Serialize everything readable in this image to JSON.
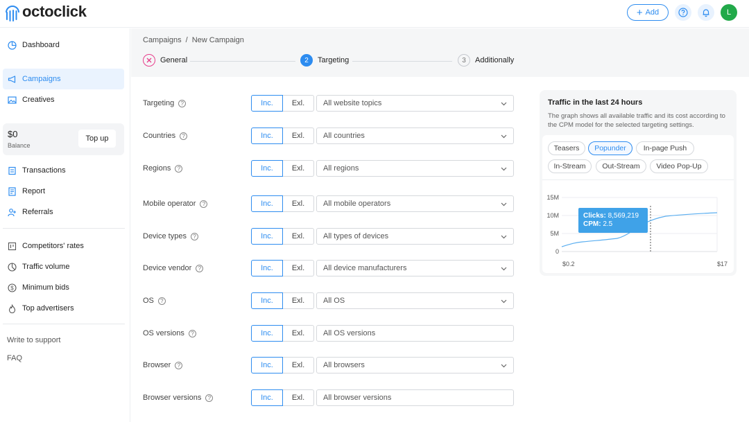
{
  "header": {
    "logo_text": "octoclick",
    "add_label": "Add",
    "avatar_letter": "L"
  },
  "sidebar": {
    "items_top": [
      {
        "label": "Dashboard",
        "icon": "dashboard-icon"
      },
      {
        "label": "Campaigns",
        "icon": "megaphone-icon"
      },
      {
        "label": "Creatives",
        "icon": "image-icon"
      }
    ],
    "balance": {
      "amount": "$0",
      "label": "Balance",
      "topup_label": "Top up"
    },
    "items_mid": [
      {
        "label": "Transactions",
        "icon": "transactions-icon"
      },
      {
        "label": "Report",
        "icon": "report-icon"
      },
      {
        "label": "Referrals",
        "icon": "referrals-icon"
      }
    ],
    "items_tools": [
      {
        "label": "Competitors' rates",
        "icon": "rates-icon"
      },
      {
        "label": "Traffic volume",
        "icon": "pie-icon"
      },
      {
        "label": "Minimum bids",
        "icon": "dollar-icon"
      },
      {
        "label": "Top advertisers",
        "icon": "flame-icon"
      }
    ],
    "links": [
      {
        "label": "Write to support"
      },
      {
        "label": "FAQ"
      }
    ]
  },
  "breadcrumb": {
    "root": "Campaigns",
    "sep": "/",
    "current": "New Campaign"
  },
  "steps": [
    {
      "label": "General",
      "state": "error"
    },
    {
      "number": "2",
      "label": "Targeting",
      "state": "active"
    },
    {
      "number": "3",
      "label": "Additionally",
      "state": "pending"
    }
  ],
  "form": {
    "inc_label": "Inc.",
    "exl_label": "Exl.",
    "help_glyph": "?",
    "rows": [
      {
        "label": "Targeting",
        "value": "All website topics",
        "dropdown": true
      },
      {
        "label": "Countries",
        "value": "All countries",
        "dropdown": true
      },
      {
        "label": "Regions",
        "value": "All regions",
        "dropdown": true
      },
      {
        "label": "Mobile operator",
        "value": "All mobile operators",
        "dropdown": true
      },
      {
        "label": "Device types",
        "value": "All types of devices",
        "dropdown": true
      },
      {
        "label": "Device vendor",
        "value": "All device manufacturers",
        "dropdown": true
      },
      {
        "label": "OS",
        "value": "All OS",
        "dropdown": true
      },
      {
        "label": "OS versions",
        "value": "All OS versions",
        "dropdown": false
      },
      {
        "label": "Browser",
        "value": "All browsers",
        "dropdown": true
      },
      {
        "label": "Browser versions",
        "value": "All browser versions",
        "dropdown": false
      }
    ]
  },
  "traffic": {
    "title": "Traffic in the last 24 hours",
    "description": "The graph shows all available traffic and its cost according to the CPM model for the selected targeting settings.",
    "chips": [
      "Teasers",
      "Popunder",
      "In-page Push",
      "In-Stream",
      "Out-Stream",
      "Video Pop-Up"
    ],
    "active_chip": "Popunder",
    "y_ticks": [
      "15M",
      "10M",
      "5M",
      "0"
    ],
    "x_ticks": [
      "$0.2",
      "$17"
    ],
    "tooltip": {
      "clicks_label": "Clicks:",
      "clicks_value": "8,569,219",
      "cpm_label": "CPM:",
      "cpm_value": "2.5"
    },
    "accent": "#2d8cf0"
  }
}
